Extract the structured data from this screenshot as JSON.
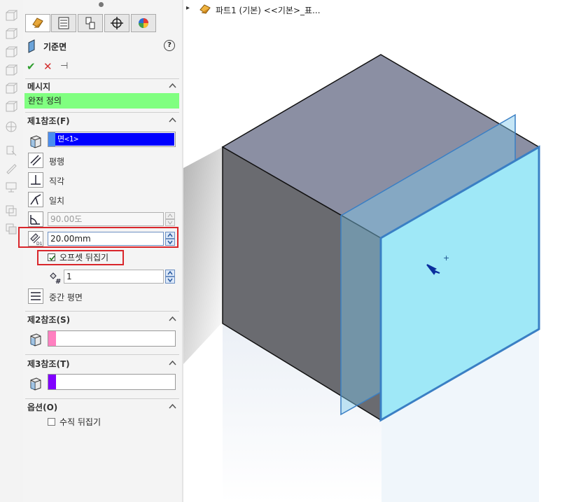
{
  "tree": {
    "expand_arrow": "▸",
    "part_label": "파트1 (기본) <<기본>_표..."
  },
  "feature": {
    "title": "기준면",
    "help": "?"
  },
  "actions": {
    "ok": "✔",
    "cancel": "✕",
    "pin": "⊣"
  },
  "message": {
    "title": "메시지",
    "text": "완전 정의"
  },
  "first_ref": {
    "title": "제1참조(F)",
    "selection": "면<1>",
    "options": [
      "평행",
      "직각",
      "일치"
    ],
    "angle_value": "90.00도",
    "offset_value": "20.00mm",
    "flip_offset_label": "오프셋 뒤집기",
    "flip_offset_checked": true,
    "count_value": "1",
    "mid_plane_label": "중간 평면"
  },
  "second_ref": {
    "title": "제2참조(S)"
  },
  "third_ref": {
    "title": "제3참조(T)"
  },
  "options_section": {
    "title": "옵션(O)",
    "flip_normal_label": "수직 뒤집기"
  },
  "colors": {
    "message_bg": "#80ff80",
    "selection_bg": "#0000ff",
    "selection_swatch": "#4a8df0",
    "second_swatch": "#ff80c0",
    "third_swatch": "#8000ff",
    "highlight": "#d9262b",
    "plane_fill": "#9fe8f7",
    "plane_edge": "#3a7fc4"
  }
}
